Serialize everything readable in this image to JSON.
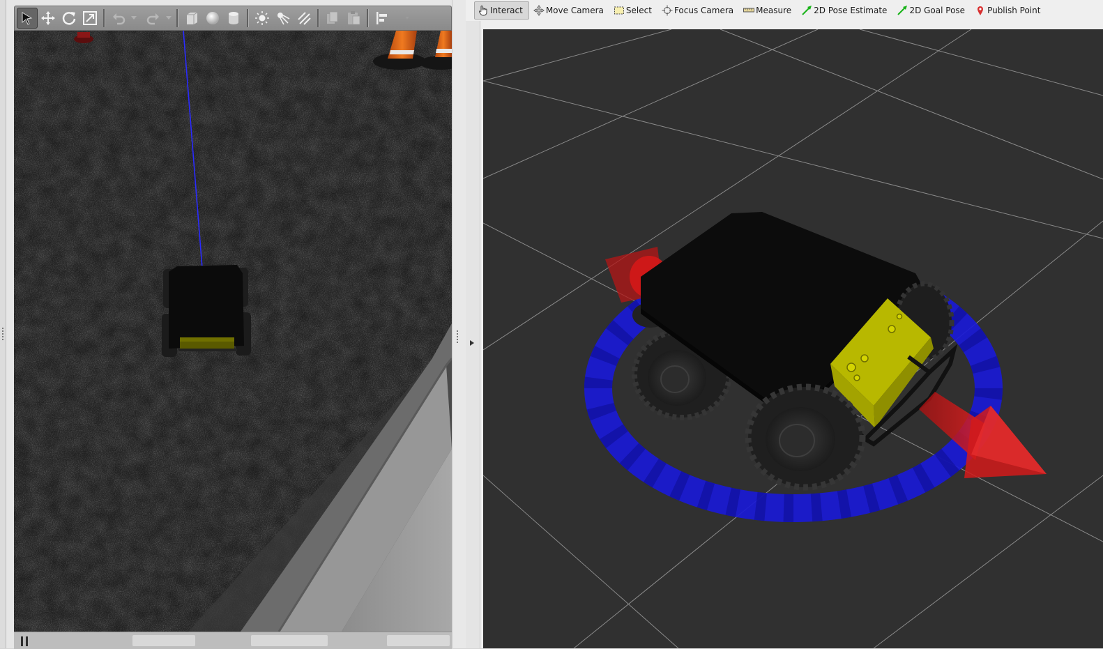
{
  "gazebo": {
    "toolbar": {
      "tools": [
        {
          "name": "select-mode",
          "icon": "arrow-cursor-icon",
          "active": true
        },
        {
          "name": "translate-mode",
          "icon": "move-arrows-icon"
        },
        {
          "name": "rotate-mode",
          "icon": "rotate-icon"
        },
        {
          "name": "scale-mode",
          "icon": "scale-icon"
        },
        {
          "name": "undo",
          "icon": "undo-icon"
        },
        {
          "name": "redo",
          "icon": "redo-icon"
        },
        {
          "name": "box-shape",
          "icon": "box-icon"
        },
        {
          "name": "sphere-shape",
          "icon": "sphere-icon"
        },
        {
          "name": "cylinder-shape",
          "icon": "cylinder-icon"
        },
        {
          "name": "point-light",
          "icon": "sun-icon"
        },
        {
          "name": "spot-light",
          "icon": "spot-light-icon"
        },
        {
          "name": "directional-light",
          "icon": "directional-light-icon"
        },
        {
          "name": "copy",
          "icon": "copy-icon"
        },
        {
          "name": "paste",
          "icon": "paste-icon"
        },
        {
          "name": "align",
          "icon": "align-icon"
        }
      ]
    }
  },
  "rviz": {
    "toolbar": {
      "tools": [
        {
          "label": "Interact",
          "icon": "hand-pointer-icon",
          "active": true
        },
        {
          "label": "Move Camera",
          "icon": "move-camera-icon"
        },
        {
          "label": "Select",
          "icon": "select-box-icon"
        },
        {
          "label": "Focus Camera",
          "icon": "focus-crosshair-icon"
        },
        {
          "label": "Measure",
          "icon": "ruler-icon"
        },
        {
          "label": "2D Pose Estimate",
          "icon": "green-arrow-icon"
        },
        {
          "label": "2D Goal Pose",
          "icon": "green-arrow-icon"
        },
        {
          "label": "Publish Point",
          "icon": "red-pin-icon"
        }
      ]
    }
  },
  "colors": {
    "robot_top": "#0c0c0c",
    "robot_bumper": "#c8c800",
    "ring": "#1a1ad6",
    "arrow_red": "#d21a1a",
    "grid": "#8a8a8a",
    "rviz_bg": "#303030"
  }
}
